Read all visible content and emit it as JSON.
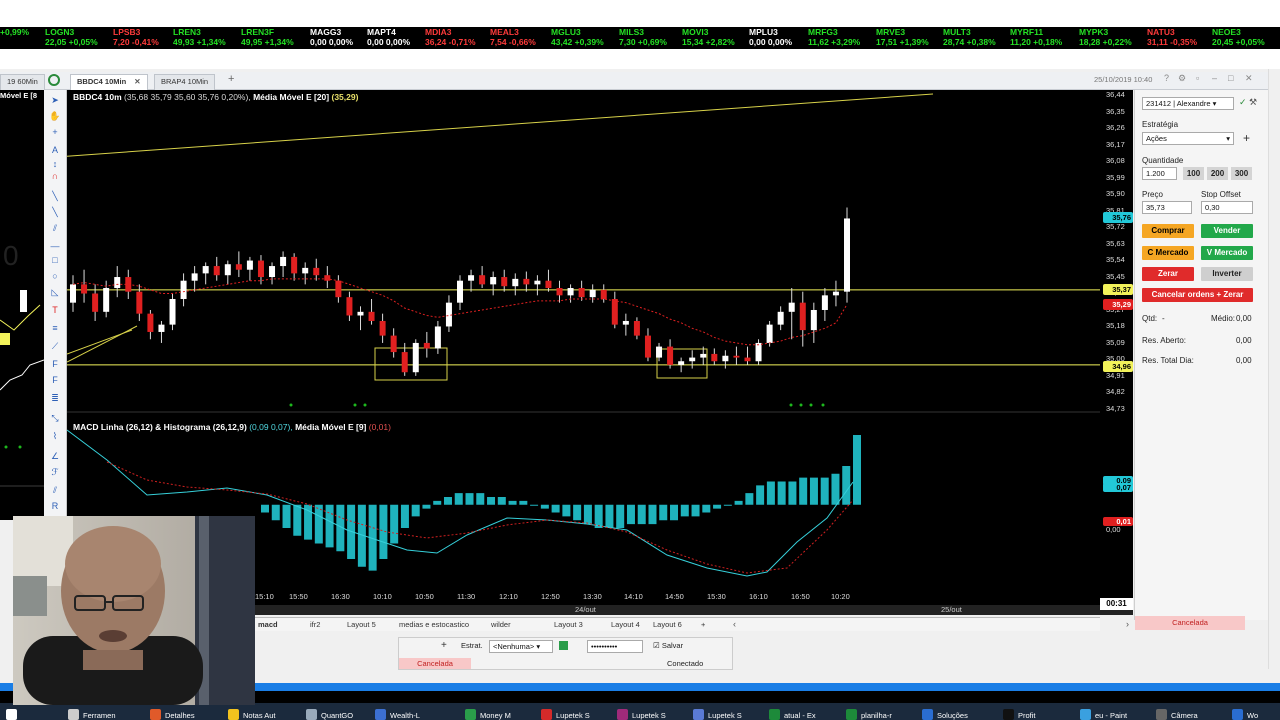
{
  "ticker": [
    {
      "sym": "",
      "val": "+0,99%",
      "color": "#25e225"
    },
    {
      "sym": "LOGN3",
      "val": "22,05 +0,05%",
      "color": "#25e225"
    },
    {
      "sym": "LPSB3",
      "val": "7,20 -0,41%",
      "color": "#ff3b3b"
    },
    {
      "sym": "LREN3",
      "val": "49,93 +1,34%",
      "color": "#25e225"
    },
    {
      "sym": "LREN3F",
      "val": "49,95 +1,34%",
      "color": "#25e225"
    },
    {
      "sym": "MAGG3",
      "val": "0,00 0,00%",
      "color": "#ffffff"
    },
    {
      "sym": "MAPT4",
      "val": "0,00 0,00%",
      "color": "#ffffff"
    },
    {
      "sym": "MDIA3",
      "val": "36,24 -0,71%",
      "color": "#ff3b3b"
    },
    {
      "sym": "MEAL3",
      "val": "7,54 -0,66%",
      "color": "#ff3b3b"
    },
    {
      "sym": "MGLU3",
      "val": "43,42 +0,39%",
      "color": "#25e225"
    },
    {
      "sym": "MILS3",
      "val": "7,30 +0,69%",
      "color": "#25e225"
    },
    {
      "sym": "MOVI3",
      "val": "15,34 +2,82%",
      "color": "#25e225"
    },
    {
      "sym": "MPLU3",
      "val": "0,00 0,00%",
      "color": "#ffffff"
    },
    {
      "sym": "MRFG3",
      "val": "11,62 +3,29%",
      "color": "#25e225"
    },
    {
      "sym": "MRVE3",
      "val": "17,51 +1,39%",
      "color": "#25e225"
    },
    {
      "sym": "MULT3",
      "val": "28,74 +0,38%",
      "color": "#25e225"
    },
    {
      "sym": "MYRF11",
      "val": "11,20 +0,18%",
      "color": "#25e225"
    },
    {
      "sym": "MYPK3",
      "val": "18,28 +0,22%",
      "color": "#25e225"
    },
    {
      "sym": "NATU3",
      "val": "31,11 -0,35%",
      "color": "#ff3b3b"
    },
    {
      "sym": "NEOE3",
      "val": "20,45 +0,05%",
      "color": "#25e225"
    }
  ],
  "window_tabs": [
    {
      "label": "19 60Min"
    },
    {
      "label": "BBDC4 10Min",
      "active": true
    },
    {
      "label": "BRAP4 10Min"
    }
  ],
  "datetime": "25/10/2019 10:40",
  "left_panel_label": "Móvel E [8",
  "price_header": {
    "ticker": "BBDC4 10m",
    "values": "(35,68  35,79  35,60  35,76  0,20%),",
    "ma_label": "Média Móvel E [20]",
    "ma_value": "(35,29)"
  },
  "macd_header": {
    "label": "MACD Linha (26,12) & Histograma (26,12,9)",
    "values": "(0,09  0,07),",
    "ma_label": "Média Móvel E [9]",
    "ma_value": "(0,01)"
  },
  "price_axis": [
    "36,44",
    "36,35",
    "36,26",
    "36,17",
    "36,08",
    "35,99",
    "35,90",
    "35,81",
    "35,72",
    "35,63",
    "35,54",
    "35,45",
    "35,36",
    "35,27",
    "35,18",
    "35,09",
    "35,00",
    "34,91",
    "34,82",
    "34,73"
  ],
  "price_tags": {
    "last": "35,76",
    "line": "35,37",
    "ma": "35,29",
    "support": "34,96",
    "last_color": "#22c8d8",
    "line_color": "#f2f25a",
    "ma_color": "#e02020"
  },
  "macd_tags": {
    "line": "0,09",
    "hist": "0,07",
    "signal": "0,01",
    "zero": "0,00"
  },
  "time_axis": [
    "15:10",
    "15:50",
    "16:30",
    "10:10",
    "10:50",
    "11:30",
    "12:10",
    "12:50",
    "13:30",
    "14:10",
    "14:50",
    "15:30",
    "16:10",
    "16:50",
    "10:20"
  ],
  "date_axis": [
    "24/out",
    "25/out"
  ],
  "time_readout": "00:31",
  "chart_data": {
    "type": "candlestick",
    "ylim": [
      34.73,
      36.44
    ],
    "series": [
      {
        "name": "BBDC4 10m",
        "ohlc": [
          [
            35.3,
            35.45,
            35.25,
            35.4
          ],
          [
            35.4,
            35.48,
            35.3,
            35.35
          ],
          [
            35.35,
            35.4,
            35.2,
            35.25
          ],
          [
            35.25,
            35.42,
            35.22,
            35.38
          ],
          [
            35.38,
            35.5,
            35.33,
            35.44
          ],
          [
            35.44,
            35.48,
            35.32,
            35.36
          ],
          [
            35.36,
            35.4,
            35.2,
            35.24
          ],
          [
            35.24,
            35.26,
            35.1,
            35.14
          ],
          [
            35.14,
            35.2,
            35.08,
            35.18
          ],
          [
            35.18,
            35.35,
            35.15,
            35.32
          ],
          [
            35.32,
            35.46,
            35.28,
            35.42
          ],
          [
            35.42,
            35.5,
            35.36,
            35.46
          ],
          [
            35.46,
            35.52,
            35.4,
            35.5
          ],
          [
            35.5,
            35.55,
            35.42,
            35.45
          ],
          [
            35.45,
            35.53,
            35.4,
            35.51
          ],
          [
            35.51,
            35.58,
            35.44,
            35.48
          ],
          [
            35.48,
            35.55,
            35.42,
            35.53
          ],
          [
            35.53,
            35.56,
            35.4,
            35.44
          ],
          [
            35.44,
            35.52,
            35.4,
            35.5
          ],
          [
            35.5,
            35.58,
            35.44,
            35.55
          ],
          [
            35.55,
            35.57,
            35.42,
            35.46
          ],
          [
            35.46,
            35.52,
            35.4,
            35.49
          ],
          [
            35.49,
            35.54,
            35.42,
            35.45
          ],
          [
            35.45,
            35.5,
            35.38,
            35.42
          ],
          [
            35.42,
            35.45,
            35.3,
            35.33
          ],
          [
            35.33,
            35.36,
            35.2,
            35.23
          ],
          [
            35.23,
            35.28,
            35.15,
            35.25
          ],
          [
            35.25,
            35.32,
            35.18,
            35.2
          ],
          [
            35.2,
            35.24,
            35.08,
            35.12
          ],
          [
            35.12,
            35.16,
            35.0,
            35.03
          ],
          [
            35.03,
            35.08,
            34.9,
            34.92
          ],
          [
            34.92,
            35.1,
            34.9,
            35.08
          ],
          [
            35.08,
            35.14,
            35.0,
            35.05
          ],
          [
            35.05,
            35.2,
            35.02,
            35.17
          ],
          [
            35.17,
            35.34,
            35.14,
            35.3
          ],
          [
            35.3,
            35.45,
            35.26,
            35.42
          ],
          [
            35.42,
            35.48,
            35.36,
            35.45
          ],
          [
            35.45,
            35.5,
            35.38,
            35.4
          ],
          [
            35.4,
            35.47,
            35.34,
            35.44
          ],
          [
            35.44,
            35.48,
            35.36,
            35.39
          ],
          [
            35.39,
            35.46,
            35.34,
            35.43
          ],
          [
            35.43,
            35.47,
            35.36,
            35.4
          ],
          [
            35.4,
            35.45,
            35.34,
            35.42
          ],
          [
            35.42,
            35.48,
            35.36,
            35.38
          ],
          [
            35.38,
            35.42,
            35.3,
            35.34
          ],
          [
            35.34,
            35.4,
            35.3,
            35.38
          ],
          [
            35.38,
            35.42,
            35.31,
            35.33
          ],
          [
            35.33,
            35.4,
            35.3,
            35.37
          ],
          [
            35.37,
            35.4,
            35.3,
            35.32
          ],
          [
            35.32,
            35.36,
            35.16,
            35.18
          ],
          [
            35.18,
            35.24,
            35.12,
            35.2
          ],
          [
            35.2,
            35.22,
            35.1,
            35.12
          ],
          [
            35.12,
            35.16,
            34.98,
            35.0
          ],
          [
            35.0,
            35.08,
            34.98,
            35.06
          ],
          [
            35.06,
            35.1,
            34.94,
            34.96
          ],
          [
            34.96,
            35.0,
            34.92,
            34.98
          ],
          [
            34.98,
            35.04,
            34.94,
            35.0
          ],
          [
            35.0,
            35.06,
            34.96,
            35.02
          ],
          [
            35.02,
            35.05,
            34.96,
            34.98
          ],
          [
            34.98,
            35.04,
            34.94,
            35.01
          ],
          [
            35.01,
            35.06,
            34.96,
            35.0
          ],
          [
            35.0,
            35.06,
            34.96,
            34.98
          ],
          [
            34.98,
            35.1,
            34.96,
            35.08
          ],
          [
            35.08,
            35.2,
            35.06,
            35.18
          ],
          [
            35.18,
            35.28,
            35.15,
            35.25
          ],
          [
            35.25,
            35.38,
            35.1,
            35.3
          ],
          [
            35.3,
            35.36,
            35.06,
            35.15
          ],
          [
            35.15,
            35.3,
            35.08,
            35.26
          ],
          [
            35.26,
            35.38,
            35.2,
            35.34
          ],
          [
            35.34,
            35.42,
            35.28,
            35.36
          ],
          [
            35.36,
            35.82,
            35.3,
            35.76
          ]
        ]
      },
      {
        "name": "Média Móvel E [20]",
        "values": [
          35.4,
          35.41,
          35.4,
          35.39,
          35.4,
          35.4,
          35.39,
          35.37,
          35.35,
          35.35,
          35.36,
          35.37,
          35.38,
          35.39,
          35.4,
          35.41,
          35.42,
          35.42,
          35.43,
          35.43,
          35.43,
          35.43,
          35.43,
          35.43,
          35.42,
          35.4,
          35.38,
          35.36,
          35.34,
          35.31,
          35.27,
          35.25,
          35.23,
          35.22,
          35.23,
          35.24,
          35.25,
          35.26,
          35.27,
          35.28,
          35.29,
          35.3,
          35.31,
          35.31,
          35.31,
          35.32,
          35.32,
          35.32,
          35.32,
          35.31,
          35.3,
          35.28,
          35.26,
          35.24,
          35.21,
          35.19,
          35.16,
          35.14,
          35.11,
          35.09,
          35.08,
          35.07,
          35.07,
          35.08,
          35.09,
          35.11,
          35.12,
          35.14,
          35.16,
          35.19,
          35.29
        ]
      }
    ],
    "hlines": [
      35.37,
      34.96
    ],
    "trendline": [
      36.1,
      36.44
    ],
    "macd": {
      "hist": [
        -0.02,
        -0.04,
        -0.06,
        -0.08,
        -0.09,
        -0.1,
        -0.11,
        -0.12,
        -0.14,
        -0.16,
        -0.17,
        -0.14,
        -0.1,
        -0.06,
        -0.03,
        -0.01,
        0.01,
        0.02,
        0.03,
        0.03,
        0.03,
        0.02,
        0.02,
        0.01,
        0.01,
        0.0,
        -0.01,
        -0.02,
        -0.03,
        -0.04,
        -0.05,
        -0.06,
        -0.06,
        -0.06,
        -0.05,
        -0.05,
        -0.05,
        -0.04,
        -0.04,
        -0.03,
        -0.03,
        -0.02,
        -0.01,
        0.0,
        0.01,
        0.03,
        0.05,
        0.06,
        0.06,
        0.06,
        0.07,
        0.07,
        0.07,
        0.08,
        0.1,
        0.18
      ]
    },
    "ylim_macd": [
      -0.22,
      0.18
    ]
  },
  "order_panel": {
    "account": "231412 | Alexandre",
    "strategy_label": "Estratégia",
    "strategy_value": "Ações",
    "qty_label": "Quantidade",
    "qty_value": "1.200",
    "qty_buttons": [
      "100",
      "200",
      "300"
    ],
    "price_label": "Preço",
    "price_value": "35,73",
    "stop_label": "Stop Offset",
    "stop_value": "0,30",
    "buy": "Comprar",
    "sell": "Vender",
    "buy_market": "C Mercado",
    "sell_market": "V Mercado",
    "zero": "Zerar",
    "invert": "Inverter",
    "cancel_zero": "Cancelar ordens + Zerar",
    "qtd_label": "Qtd:",
    "qtd_value": "-",
    "avg_label": "Médio:",
    "avg_value": "0,00",
    "res_open_label": "Res. Aberto:",
    "res_open_value": "0,00",
    "res_total_label": "Res. Total Dia:",
    "res_total_value": "0,00",
    "cancel_status": "Cancelada"
  },
  "layout_tabs": [
    "macd",
    "ifr2",
    "Layout 5",
    "medias e estocastico",
    "wilder",
    "Layout 3",
    "Layout 4",
    "Layout 6"
  ],
  "strategy_bar": {
    "label": "Estrat.",
    "value": "<Nenhuma>",
    "password": "••••••••••",
    "save": "Salvar",
    "status_left": "Cancelada",
    "status_right": "Conectado"
  },
  "taskbar": [
    {
      "label": "Ferramen",
      "color": "#cccccc"
    },
    {
      "label": "Detalhes",
      "color": "#e05a2a"
    },
    {
      "label": "Notas Aut",
      "color": "#f2c21e"
    },
    {
      "label": "QuantGO",
      "color": "#9ab"
    },
    {
      "label": "Wealth-L",
      "color": "#3c6fd1"
    },
    {
      "label": "Money M",
      "color": "#2a9d4a"
    },
    {
      "label": "Lupetek S",
      "color": "#d42a2a"
    },
    {
      "label": "Lupetek S",
      "color": "#a02a7a"
    },
    {
      "label": "Lupetek S",
      "color": "#5a7ad4"
    },
    {
      "label": "atual - Ex",
      "color": "#1d8a3a"
    },
    {
      "label": "planilha-r",
      "color": "#1d8a3a"
    },
    {
      "label": "Soluções",
      "color": "#2a6dd1"
    },
    {
      "label": "Profit",
      "color": "#111"
    },
    {
      "label": "eu - Paint",
      "color": "#3aa0e0"
    },
    {
      "label": "Câmera",
      "color": "#666"
    },
    {
      "label": "Wo",
      "color": "#2a6dd1"
    }
  ]
}
